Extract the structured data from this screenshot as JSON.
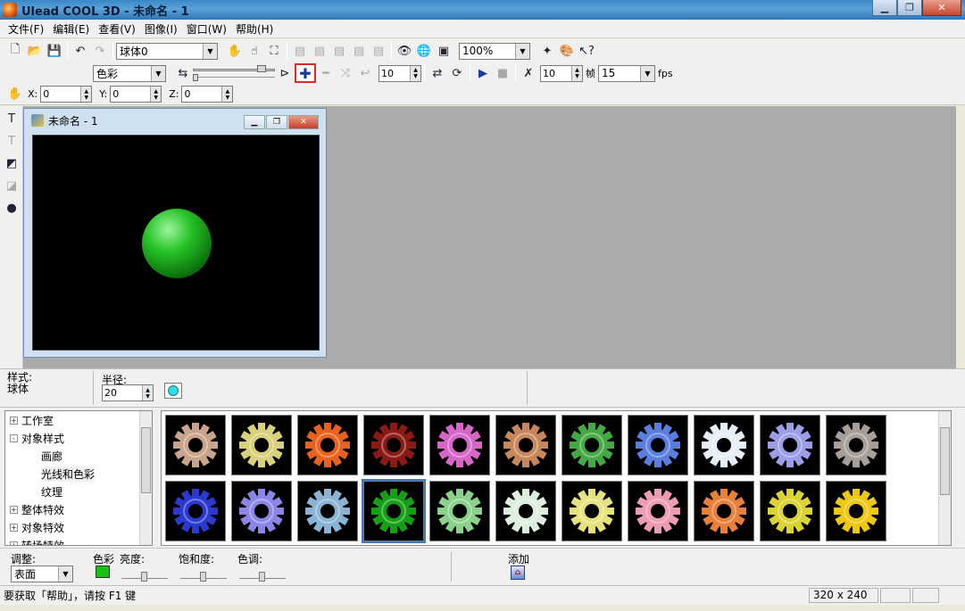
{
  "window": {
    "title": "Ulead COOL 3D - 未命名 - 1"
  },
  "menu": [
    "文件(F)",
    "编辑(E)",
    "查看(V)",
    "图像(I)",
    "窗口(W)",
    "帮助(H)"
  ],
  "toolbar1": {
    "object_select": "球体0",
    "zoom": "100%"
  },
  "toolbar2": {
    "property_select": "色彩",
    "frame_value": "10",
    "frame_count": "10",
    "frame_unit": "帧",
    "fps_value": "15",
    "fps_unit": "fps"
  },
  "toolbar3": {
    "x_label": "X:",
    "x_value": "0",
    "y_label": "Y:",
    "y_value": "0",
    "z_label": "Z:",
    "z_value": "0"
  },
  "document": {
    "title": "未命名 - 1",
    "sphere_color": "#22b422"
  },
  "attributes": {
    "style_label": "样式:",
    "style_value": "球体",
    "radius_label": "半径:",
    "radius_value": "20"
  },
  "tree": {
    "items": [
      {
        "label": "工作室",
        "toggle": "+",
        "child": false
      },
      {
        "label": "对象样式",
        "toggle": "-",
        "child": false
      },
      {
        "label": "画廊",
        "child": true
      },
      {
        "label": "光线和色彩",
        "child": true,
        "selected": true
      },
      {
        "label": "纹理",
        "child": true
      },
      {
        "label": "整体特效",
        "toggle": "+",
        "child": false
      },
      {
        "label": "对象特效",
        "toggle": "+",
        "child": false
      },
      {
        "label": "转场特效",
        "toggle": "+",
        "child": false
      }
    ]
  },
  "gallery": {
    "colors": [
      "#c9a48a",
      "#d8d07a",
      "#e8621e",
      "#8c1a14",
      "#d866c8",
      "#c8875a",
      "#44a844",
      "#5a7ee0",
      "#e6eef8",
      "#9a9ee8",
      "#a89e98",
      "#2a3ad0",
      "#8a86e8",
      "#8ab4d4",
      "#14a014",
      "#8ad28a",
      "#dceedd",
      "#e6e27e",
      "#ee9cb4",
      "#e8803a",
      "#dcd232",
      "#ecc810"
    ],
    "selected_index": 14
  },
  "adjust": {
    "adjust_label": "调整:",
    "adjust_value": "表面",
    "color_label": "色彩",
    "brightness_label": "亮度:",
    "saturation_label": "饱和度:",
    "hue_label": "色调:",
    "add_label": "添加",
    "swatch_color": "#17c217"
  },
  "status": {
    "hint": "要获取「帮助」，请按 F1 键",
    "size": "320 x 240"
  }
}
